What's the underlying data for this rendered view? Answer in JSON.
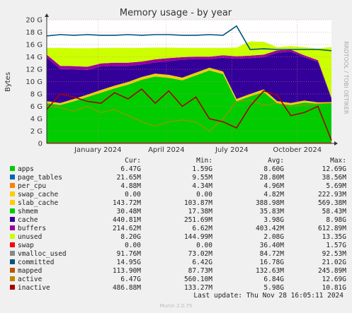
{
  "chart_data": {
    "type": "area",
    "title": "Memory usage - by year",
    "ylabel": "Bytes",
    "side_label": "RRDTOOL / TOBI OETIKER",
    "y_ticks": [
      "0",
      "2 G",
      "4 G",
      "6 G",
      "8 G",
      "10 G",
      "12 G",
      "14 G",
      "16 G",
      "18 G",
      "20 G"
    ],
    "ylim": [
      0,
      20
    ],
    "x_ticks": [
      "January 2024",
      "April 2024",
      "July 2024",
      "October 2024"
    ],
    "grid": true,
    "stack_series": [
      {
        "name": "apps",
        "color": "#00cc00",
        "values": [
          6.5,
          6.2,
          6.8,
          7.5,
          8.2,
          8.9,
          9.5,
          10.3,
          10.8,
          10.6,
          10.2,
          11.0,
          11.8,
          11.2,
          6.8,
          7.6,
          8.3,
          6.5,
          6.2,
          6.6,
          6.4,
          6.5
        ]
      },
      {
        "name": "page_tables",
        "color": "#0066b3",
        "values": [
          0.02,
          0.02,
          0.02,
          0.02,
          0.02,
          0.02,
          0.02,
          0.02,
          0.02,
          0.02,
          0.02,
          0.02,
          0.02,
          0.02,
          0.02,
          0.02,
          0.02,
          0.02,
          0.02,
          0.02,
          0.02,
          0.02
        ]
      },
      {
        "name": "swap_cache",
        "color": "#ffcc00",
        "values": [
          0,
          0,
          0,
          0,
          0,
          0,
          0,
          0,
          0,
          0,
          0,
          0,
          0,
          0,
          0,
          0,
          0,
          0,
          0,
          0,
          0,
          0
        ]
      },
      {
        "name": "slab_cache",
        "color": "#ffcc00",
        "values": [
          0.3,
          0.3,
          0.35,
          0.35,
          0.4,
          0.4,
          0.4,
          0.4,
          0.45,
          0.45,
          0.4,
          0.4,
          0.4,
          0.4,
          0.35,
          0.35,
          0.4,
          0.3,
          0.3,
          0.3,
          0.2,
          0.15
        ]
      },
      {
        "name": "shmem",
        "color": "#00cc00",
        "values": [
          0.03,
          0.03,
          0.03,
          0.03,
          0.03,
          0.03,
          0.03,
          0.03,
          0.03,
          0.03,
          0.03,
          0.03,
          0.03,
          0.03,
          0.03,
          0.03,
          0.03,
          0.03,
          0.03,
          0.03,
          0.03,
          0.03
        ]
      },
      {
        "name": "cache",
        "color": "#330099",
        "values": [
          7.0,
          5.5,
          4.8,
          4.0,
          3.8,
          3.2,
          2.6,
          2.0,
          1.8,
          2.2,
          2.9,
          2.2,
          1.4,
          2.2,
          6.5,
          5.8,
          5.2,
          7.8,
          8.3,
          7.0,
          6.5,
          0.5
        ]
      },
      {
        "name": "buffers",
        "color": "#990099",
        "values": [
          0.5,
          0.5,
          0.5,
          0.5,
          0.5,
          0.5,
          0.5,
          0.5,
          0.5,
          0.5,
          0.4,
          0.4,
          0.4,
          0.4,
          0.4,
          0.4,
          0.4,
          0.4,
          0.3,
          0.3,
          0.3,
          0.2
        ]
      },
      {
        "name": "unused",
        "color": "#ccff00",
        "values": [
          1.1,
          2.9,
          2.9,
          3.0,
          2.5,
          2.4,
          2.4,
          2.2,
          1.9,
          1.7,
          1.5,
          1.4,
          1.4,
          1.2,
          1.4,
          2.3,
          2.1,
          0.5,
          0.6,
          1.3,
          1.9,
          8.2
        ]
      }
    ],
    "line_series": [
      {
        "name": "swap",
        "color": "#ff0000",
        "values": [
          0,
          0,
          0,
          0,
          0,
          0,
          0,
          0,
          0,
          0,
          0,
          0,
          0,
          0,
          0,
          0,
          0,
          0,
          0,
          0,
          0,
          0
        ]
      },
      {
        "name": "vmalloc_used",
        "color": "#888888",
        "values": [
          0.08,
          0.08,
          0.08,
          0.08,
          0.08,
          0.08,
          0.08,
          0.08,
          0.08,
          0.08,
          0.08,
          0.09,
          0.09,
          0.09,
          0.09,
          0.09,
          0.09,
          0.09,
          0.09,
          0.09,
          0.09,
          0.09
        ]
      },
      {
        "name": "committed",
        "color": "#005580",
        "values": [
          17.4,
          17.6,
          17.5,
          17.6,
          17.5,
          17.5,
          17.6,
          17.5,
          17.6,
          17.6,
          17.5,
          17.5,
          17.6,
          17.5,
          19.0,
          15.2,
          15.3,
          15.2,
          15.2,
          15.2,
          15.2,
          15.0
        ]
      },
      {
        "name": "mapped",
        "color": "#bb5500",
        "values": [
          0.12,
          0.12,
          0.12,
          0.12,
          0.12,
          0.12,
          0.12,
          0.12,
          0.12,
          0.12,
          0.12,
          0.12,
          0.12,
          0.12,
          0.12,
          0.12,
          0.12,
          0.12,
          0.12,
          0.12,
          0.12,
          0.11
        ]
      },
      {
        "name": "active",
        "color": "#bb8800",
        "values": [
          6.0,
          5.8,
          5.2,
          6.0,
          5.0,
          5.5,
          4.5,
          3.5,
          2.8,
          3.5,
          3.8,
          3.5,
          2.0,
          4.0,
          6.8,
          7.0,
          6.2,
          6.5,
          6.0,
          6.2,
          6.4,
          6.5
        ]
      },
      {
        "name": "inactive",
        "color": "#aa0000",
        "values": [
          5.5,
          8.0,
          7.5,
          6.8,
          6.5,
          8.2,
          7.2,
          8.8,
          6.5,
          8.5,
          6.0,
          7.5,
          4.0,
          3.5,
          2.5,
          6.0,
          8.5,
          7.8,
          4.5,
          5.0,
          6.0,
          0.5
        ]
      }
    ],
    "legend": {
      "headers": {
        "cur": "Cur:",
        "min": "Min:",
        "avg": "Avg:",
        "max": "Max:"
      },
      "rows": [
        {
          "name": "apps",
          "color": "#00cc00",
          "cur": "6.47G",
          "min": "1.59G",
          "avg": "8.60G",
          "max": "12.69G"
        },
        {
          "name": "page_tables",
          "color": "#0066b3",
          "cur": "21.65M",
          "min": "9.55M",
          "avg": "28.80M",
          "max": "38.56M"
        },
        {
          "name": "per_cpu",
          "color": "#ff8000",
          "cur": "4.88M",
          "min": "4.34M",
          "avg": "4.96M",
          "max": "5.69M"
        },
        {
          "name": "swap_cache",
          "color": "#ffcc00",
          "cur": "0.00",
          "min": "0.00",
          "avg": "4.82M",
          "max": "222.93M"
        },
        {
          "name": "slab_cache",
          "color": "#ffcc00",
          "cur": "143.72M",
          "min": "103.87M",
          "avg": "388.98M",
          "max": "569.38M"
        },
        {
          "name": "shmem",
          "color": "#00cc00",
          "cur": "30.48M",
          "min": "17.38M",
          "avg": "35.83M",
          "max": "58.43M"
        },
        {
          "name": "cache",
          "color": "#330099",
          "cur": "440.81M",
          "min": "251.69M",
          "avg": "3.98G",
          "max": "8.98G"
        },
        {
          "name": "buffers",
          "color": "#990099",
          "cur": "214.62M",
          "min": "6.62M",
          "avg": "403.42M",
          "max": "612.89M"
        },
        {
          "name": "unused",
          "color": "#ccff00",
          "cur": "8.20G",
          "min": "144.99M",
          "avg": "2.08G",
          "max": "13.35G"
        },
        {
          "name": "swap",
          "color": "#ff0000",
          "cur": "0.00",
          "min": "0.00",
          "avg": "36.40M",
          "max": "1.57G"
        },
        {
          "name": "vmalloc_used",
          "color": "#888888",
          "cur": "91.76M",
          "min": "73.02M",
          "avg": "84.72M",
          "max": "92.53M"
        },
        {
          "name": "committed",
          "color": "#005580",
          "cur": "14.95G",
          "min": "6.42G",
          "avg": "16.78G",
          "max": "21.02G"
        },
        {
          "name": "mapped",
          "color": "#bb5500",
          "cur": "113.90M",
          "min": "87.73M",
          "avg": "132.63M",
          "max": "245.89M"
        },
        {
          "name": "active",
          "color": "#bb8800",
          "cur": "6.47G",
          "min": "560.10M",
          "avg": "6.84G",
          "max": "12.69G"
        },
        {
          "name": "inactive",
          "color": "#aa0000",
          "cur": "486.88M",
          "min": "133.27M",
          "avg": "5.98G",
          "max": "10.81G"
        }
      ]
    }
  },
  "footer": {
    "last_update": "Last update: Thu Nov 28 16:05:11 2024",
    "munin": "Munin 2.0.75"
  }
}
